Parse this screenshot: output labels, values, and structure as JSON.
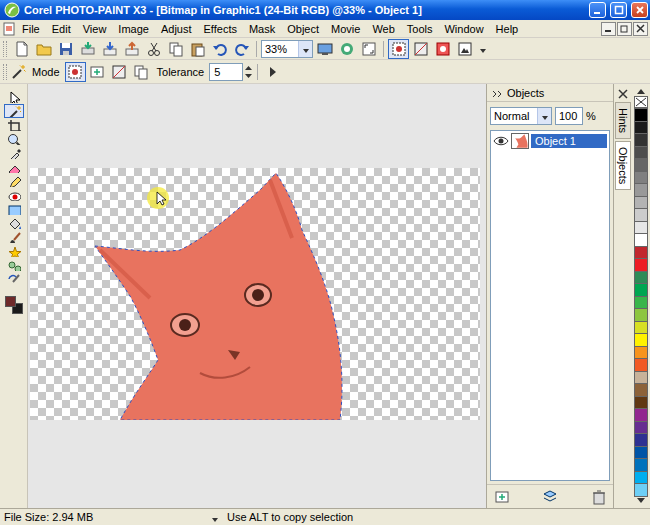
{
  "window": {
    "title": "Corel PHOTO-PAINT X3 - [Bitmap in Graphic1 (24-Bit RGB) @33% - Object 1]"
  },
  "menu": [
    "File",
    "Edit",
    "View",
    "Image",
    "Adjust",
    "Effects",
    "Mask",
    "Object",
    "Movie",
    "Web",
    "Tools",
    "Window",
    "Help"
  ],
  "standard_toolbar": {
    "zoom": "33%",
    "toggles": [
      {
        "pressed": true
      },
      {
        "pressed": false
      },
      {
        "pressed": false
      },
      {
        "pressed": false
      }
    ]
  },
  "property_bar": {
    "mode_label": "Mode",
    "modes": [
      {
        "selected": true
      },
      {
        "selected": false
      },
      {
        "selected": false
      },
      {
        "selected": false
      }
    ],
    "tolerance_label": "Tolerance",
    "tolerance": "5"
  },
  "toolbox": {
    "tools": [
      {
        "selected": false
      },
      {
        "selected": true
      },
      {
        "selected": false
      },
      {
        "selected": false
      },
      {
        "selected": false
      },
      {
        "selected": false
      },
      {
        "selected": false
      },
      {
        "selected": false
      },
      {
        "selected": false
      },
      {
        "selected": false
      },
      {
        "selected": false
      },
      {
        "selected": false
      },
      {
        "selected": false
      },
      {
        "selected": false
      }
    ],
    "foreground": {
      "color": "#6e2a2a"
    },
    "background": {
      "color": "#1a1a1a"
    }
  },
  "objects_docker": {
    "title": "Objects",
    "blend_mode": "Normal",
    "opacity": "100",
    "opacity_unit": "%",
    "objects": [
      {
        "name": "Object 1",
        "visible": true,
        "selected": true
      }
    ]
  },
  "side_tabs": [
    {
      "label": "Hints",
      "selected": false
    },
    {
      "label": "Objects",
      "selected": true
    }
  ],
  "palette": [
    {
      "color": "#000000"
    },
    {
      "color": "#1a1a1a"
    },
    {
      "color": "#333333"
    },
    {
      "color": "#4d4d4d"
    },
    {
      "color": "#666666"
    },
    {
      "color": "#808080"
    },
    {
      "color": "#999999"
    },
    {
      "color": "#b3b3b3"
    },
    {
      "color": "#cccccc"
    },
    {
      "color": "#e6e6e6"
    },
    {
      "color": "#ffffff"
    },
    {
      "color": "#c1272d"
    },
    {
      "color": "#ed1c24"
    },
    {
      "color": "#2e8b57"
    },
    {
      "color": "#00a651"
    },
    {
      "color": "#39b54a"
    },
    {
      "color": "#8dc63f"
    },
    {
      "color": "#d7df23"
    },
    {
      "color": "#fff200"
    },
    {
      "color": "#f7941d"
    },
    {
      "color": "#f15a24"
    },
    {
      "color": "#c7b299"
    },
    {
      "color": "#8c6239"
    },
    {
      "color": "#603813"
    },
    {
      "color": "#92278f"
    },
    {
      "color": "#662d91"
    },
    {
      "color": "#2e3192"
    },
    {
      "color": "#0054a6"
    },
    {
      "color": "#0072bc"
    },
    {
      "color": "#00aeef"
    },
    {
      "color": "#6dcff6"
    }
  ],
  "status_bar": {
    "file_size": "File Size: 2.94 MB",
    "hint": "Use ALT to copy selection"
  }
}
